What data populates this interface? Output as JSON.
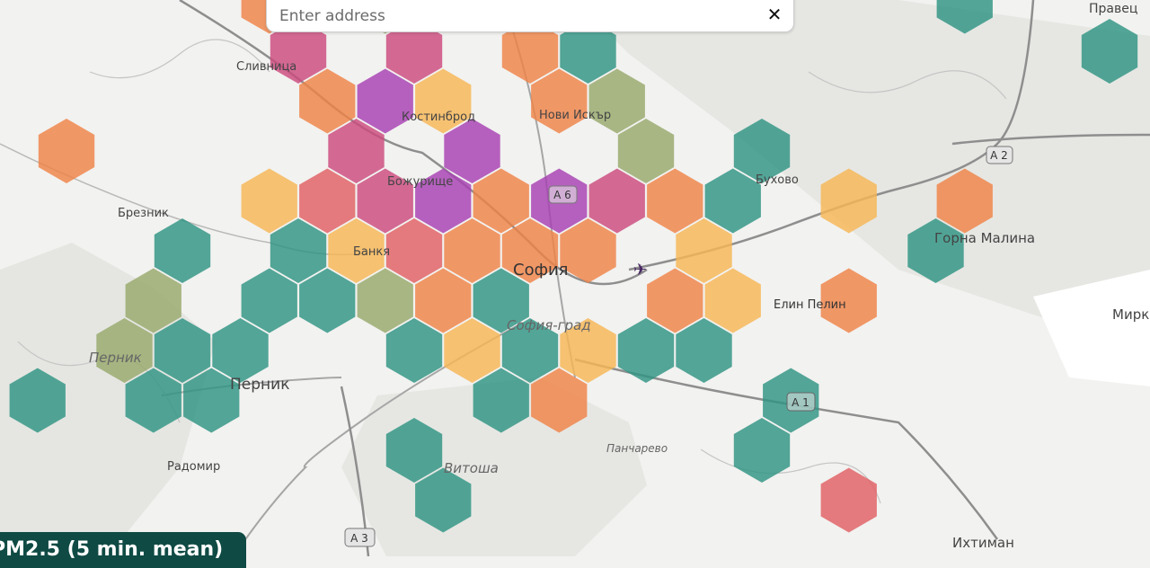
{
  "search": {
    "placeholder": "Enter address",
    "clear_glyph": "✕"
  },
  "legend": {
    "title": "PM2.5 (5 min. mean)"
  },
  "map_labels": {
    "pravets": "Правец",
    "slivnitsa": "Сливница",
    "kostinbrod": "Костинброд",
    "novi_iskar": "Нови Искър",
    "a2": "A 2",
    "buhovo": "Бухово",
    "breznik": "Брезник",
    "bozhurishte": "Божурище",
    "a6": "A 6",
    "gorna_malina": "Горна Малина",
    "bankya": "Банкя",
    "sofia": "София",
    "elin_pelin": "Елин Пелин",
    "mirkovo": "Мирк",
    "sofia_grad": "София-град",
    "pernik_region": "Перник",
    "pernik": "Перник",
    "a1": "A 1",
    "pancharevo": "Панчарево",
    "radomir": "Радомир",
    "vitosha": "Витоша",
    "a3": "A 3",
    "ihtiman": "Ихтиман"
  },
  "colors": {
    "teal": "#2e9483",
    "olive": "#97a86b",
    "yellow": "#f6b654",
    "orange": "#ef8347",
    "red": "#e05f63",
    "magenta": "#cc4b7e",
    "purple": "#a73fb2",
    "legend_bg": "#0f4a44"
  },
  "cells": [
    [
      "magenta",
      0,
      0
    ],
    [
      "orange",
      0,
      -1
    ],
    [
      "olive",
      2,
      -1
    ],
    [
      "teal",
      12,
      -1
    ],
    [
      "magenta",
      2,
      0
    ],
    [
      "orange",
      4,
      0
    ],
    [
      "teal",
      5,
      0
    ],
    [
      "teal",
      14,
      0
    ],
    [
      "orange",
      1,
      1
    ],
    [
      "purple",
      2,
      1
    ],
    [
      "yellow",
      3,
      1
    ],
    [
      "orange",
      5,
      1
    ],
    [
      "olive",
      6,
      1
    ],
    [
      "magenta",
      1,
      2
    ],
    [
      "purple",
      3,
      2
    ],
    [
      "olive",
      6,
      2
    ],
    [
      "teal",
      8,
      2
    ],
    [
      "yellow",
      0,
      3
    ],
    [
      "red",
      1,
      3
    ],
    [
      "magenta",
      2,
      3
    ],
    [
      "purple",
      3,
      3
    ],
    [
      "orange",
      4,
      3
    ],
    [
      "purple",
      5,
      3
    ],
    [
      "magenta",
      6,
      3
    ],
    [
      "orange",
      7,
      3
    ],
    [
      "teal",
      8,
      3
    ],
    [
      "yellow",
      10,
      3
    ],
    [
      "orange",
      12,
      3
    ],
    [
      "teal",
      -2,
      4
    ],
    [
      "teal",
      0,
      4
    ],
    [
      "yellow",
      1,
      4
    ],
    [
      "red",
      2,
      4
    ],
    [
      "orange",
      3,
      4
    ],
    [
      "orange",
      4,
      4
    ],
    [
      "orange",
      5,
      4
    ],
    [
      "yellow",
      7,
      4
    ],
    [
      "teal",
      11,
      4
    ],
    [
      "olive",
      -2,
      5
    ],
    [
      "teal",
      0,
      5
    ],
    [
      "teal",
      1,
      5
    ],
    [
      "olive",
      2,
      5
    ],
    [
      "orange",
      3,
      5
    ],
    [
      "teal",
      4,
      5
    ],
    [
      "orange",
      7,
      5
    ],
    [
      "yellow",
      8,
      5
    ],
    [
      "orange",
      10,
      5
    ],
    [
      "olive",
      -3,
      6
    ],
    [
      "teal",
      -2,
      6
    ],
    [
      "teal",
      -1,
      6
    ],
    [
      "teal",
      2,
      6
    ],
    [
      "yellow",
      3,
      6
    ],
    [
      "teal",
      4,
      6
    ],
    [
      "yellow",
      5,
      6
    ],
    [
      "teal",
      6,
      6
    ],
    [
      "teal",
      7,
      6
    ],
    [
      "teal",
      -4,
      7
    ],
    [
      "teal",
      -2,
      7
    ],
    [
      "teal",
      -1,
      7
    ],
    [
      "teal",
      4,
      7
    ],
    [
      "orange",
      5,
      7
    ],
    [
      "teal",
      9,
      7
    ],
    [
      "teal",
      2,
      8
    ],
    [
      "teal",
      8,
      8
    ],
    [
      "teal",
      3,
      9
    ],
    [
      "red",
      10,
      9
    ],
    [
      "teal",
      -7,
      1
    ],
    [
      "orange",
      -4,
      2
    ]
  ]
}
